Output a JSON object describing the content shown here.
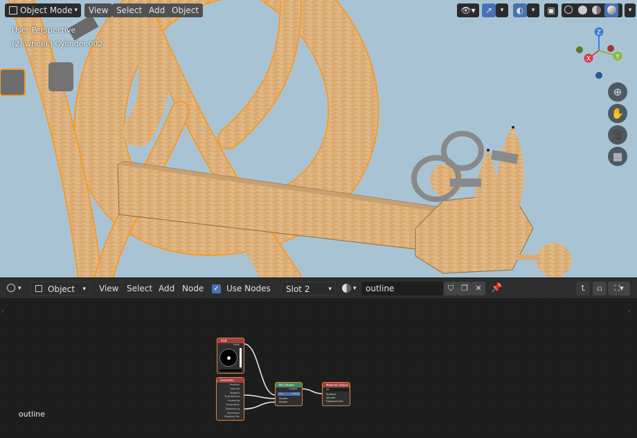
{
  "viewport": {
    "mode_label": "Object Mode",
    "menus": [
      "View",
      "Select",
      "Add",
      "Object"
    ],
    "overlay_line1": "User Perspective",
    "overlay_line2": "(2) wheel | Cylinder.002",
    "gizmo": {
      "z": "Z",
      "x": "X",
      "y": "Y"
    }
  },
  "node_editor": {
    "type_label": "Object",
    "menus": [
      "View",
      "Select",
      "Add",
      "Node"
    ],
    "use_nodes_label": "Use Nodes",
    "use_nodes": true,
    "slot_label": "Slot 2",
    "material_name": "outline",
    "canvas_label": "outline",
    "nodes": {
      "rgb": {
        "title": "RGB",
        "output": "Color"
      },
      "geometry": {
        "title": "Geometry",
        "outputs": [
          "Position",
          "Normal",
          "Tangent",
          "True Normal",
          "Incoming",
          "Parametric",
          "Backfacing",
          "Pointiness",
          "Random Per Island"
        ]
      },
      "mix": {
        "title": "Mix Shader",
        "output": "Shader",
        "fac_label": "Fac",
        "fac_value": "0.000",
        "inputs": [
          "Shader",
          "Shader"
        ]
      },
      "output": {
        "title": "Material Output",
        "target": "All",
        "inputs": [
          "Surface",
          "Volume",
          "Displacement"
        ]
      }
    }
  },
  "colors": {
    "sky": "#a8c4d4",
    "wood": "#e2b886",
    "selection": "#f59a2a",
    "accent": "#4772b3"
  }
}
